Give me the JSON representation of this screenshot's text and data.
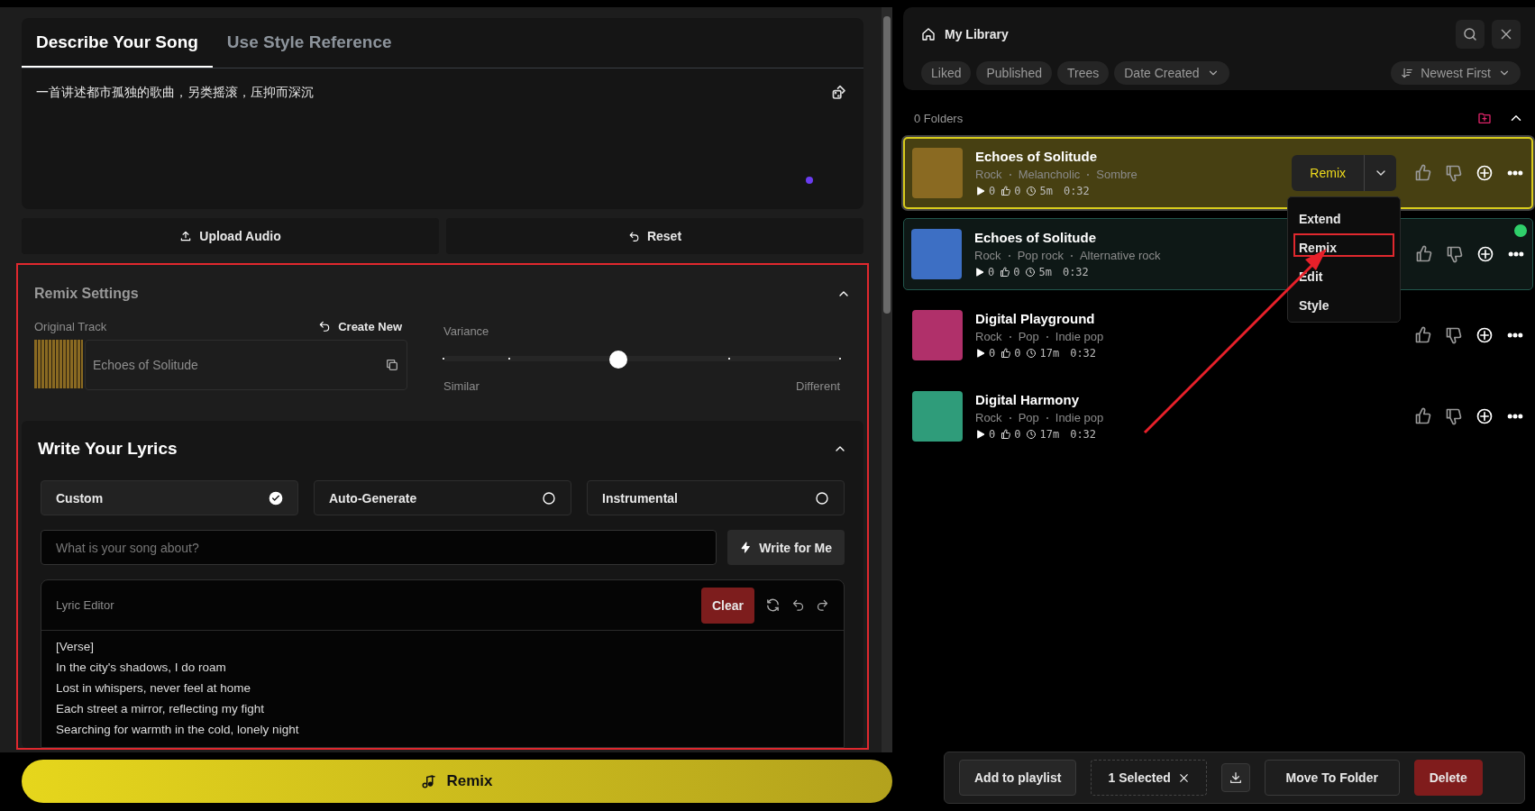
{
  "prompt_tabs": [
    {
      "label": "Describe Your Song",
      "selected": true
    },
    {
      "label": "Use Style Reference",
      "selected": false
    }
  ],
  "description": "一首讲述都市孤独的歌曲，另类摇滚，压抑而深沉",
  "upload_button": "Upload Audio",
  "reset_button": "Reset",
  "remix_settings": {
    "title": "Remix Settings",
    "expanded": true,
    "highlighted": true,
    "original_track_label": "Original Track",
    "create_new": "Create New",
    "track_name": "Echoes of Solitude",
    "variance_label": "Variance",
    "variance": {
      "level": 0.44
    },
    "min_label": "Similar",
    "max_label": "Different"
  },
  "lyrics": {
    "title": "Write Your Lyrics",
    "expanded": true,
    "modes": [
      {
        "label": "Custom",
        "selected": true
      },
      {
        "label": "Auto-Generate",
        "selected": false
      },
      {
        "label": "Instrumental",
        "selected": false
      }
    ],
    "prompt_placeholder": "What is your song about?",
    "write_button": "Write for Me",
    "editor_label": "Lyric Editor",
    "clear_button": "Clear",
    "lines": [
      "[Verse]",
      "In the city's shadows, I do roam",
      "Lost in whispers, never feel at home",
      "Each street a mirror, reflecting my fight",
      "Searching for warmth in the cold, lonely night"
    ]
  },
  "generate_button": "Remix",
  "library": {
    "title": "My Library",
    "filters": [
      {
        "label": "Liked",
        "kind": "chip"
      },
      {
        "label": "Published",
        "kind": "chip"
      },
      {
        "label": "Trees",
        "kind": "chip"
      },
      {
        "label": "Date Created",
        "kind": "dropdown"
      }
    ],
    "sort": "Newest First",
    "folders": "0 Folders",
    "tracks": [
      {
        "title": "Echoes of Solitude",
        "tags": [
          "Rock",
          "Melancholic",
          "Sombre"
        ],
        "plays": "0",
        "likes": "0",
        "age": "5m",
        "duration": "0:32",
        "color": "#8a6a22",
        "active": true,
        "selected": false,
        "remix_button": "Remix",
        "menu": [
          {
            "label": "Extend",
            "highlighted": false
          },
          {
            "label": "Remix",
            "highlighted": true
          },
          {
            "label": "Edit",
            "highlighted": false
          },
          {
            "label": "Style",
            "highlighted": false
          }
        ]
      },
      {
        "title": "Echoes of Solitude",
        "tags": [
          "Rock",
          "Pop rock",
          "Alternative rock"
        ],
        "plays": "0",
        "likes": "0",
        "age": "5m",
        "duration": "0:32",
        "color": "#3d6fc4",
        "active": false,
        "selected": true
      },
      {
        "title": "Digital Playground",
        "tags": [
          "Rock",
          "Pop",
          "Indie pop"
        ],
        "plays": "0",
        "likes": "0",
        "age": "17m",
        "duration": "0:32",
        "color": "#b0306a",
        "active": false,
        "selected": false
      },
      {
        "title": "Digital Harmony",
        "tags": [
          "Rock",
          "Pop",
          "Indie pop"
        ],
        "plays": "0",
        "likes": "0",
        "age": "17m",
        "duration": "0:32",
        "color": "#2f9c7a",
        "active": false,
        "selected": false
      }
    ]
  },
  "action_bar": {
    "add_to_playlist": "Add to playlist",
    "selected_count": "1 Selected",
    "move_to_folder": "Move To Folder",
    "delete": "Delete"
  }
}
